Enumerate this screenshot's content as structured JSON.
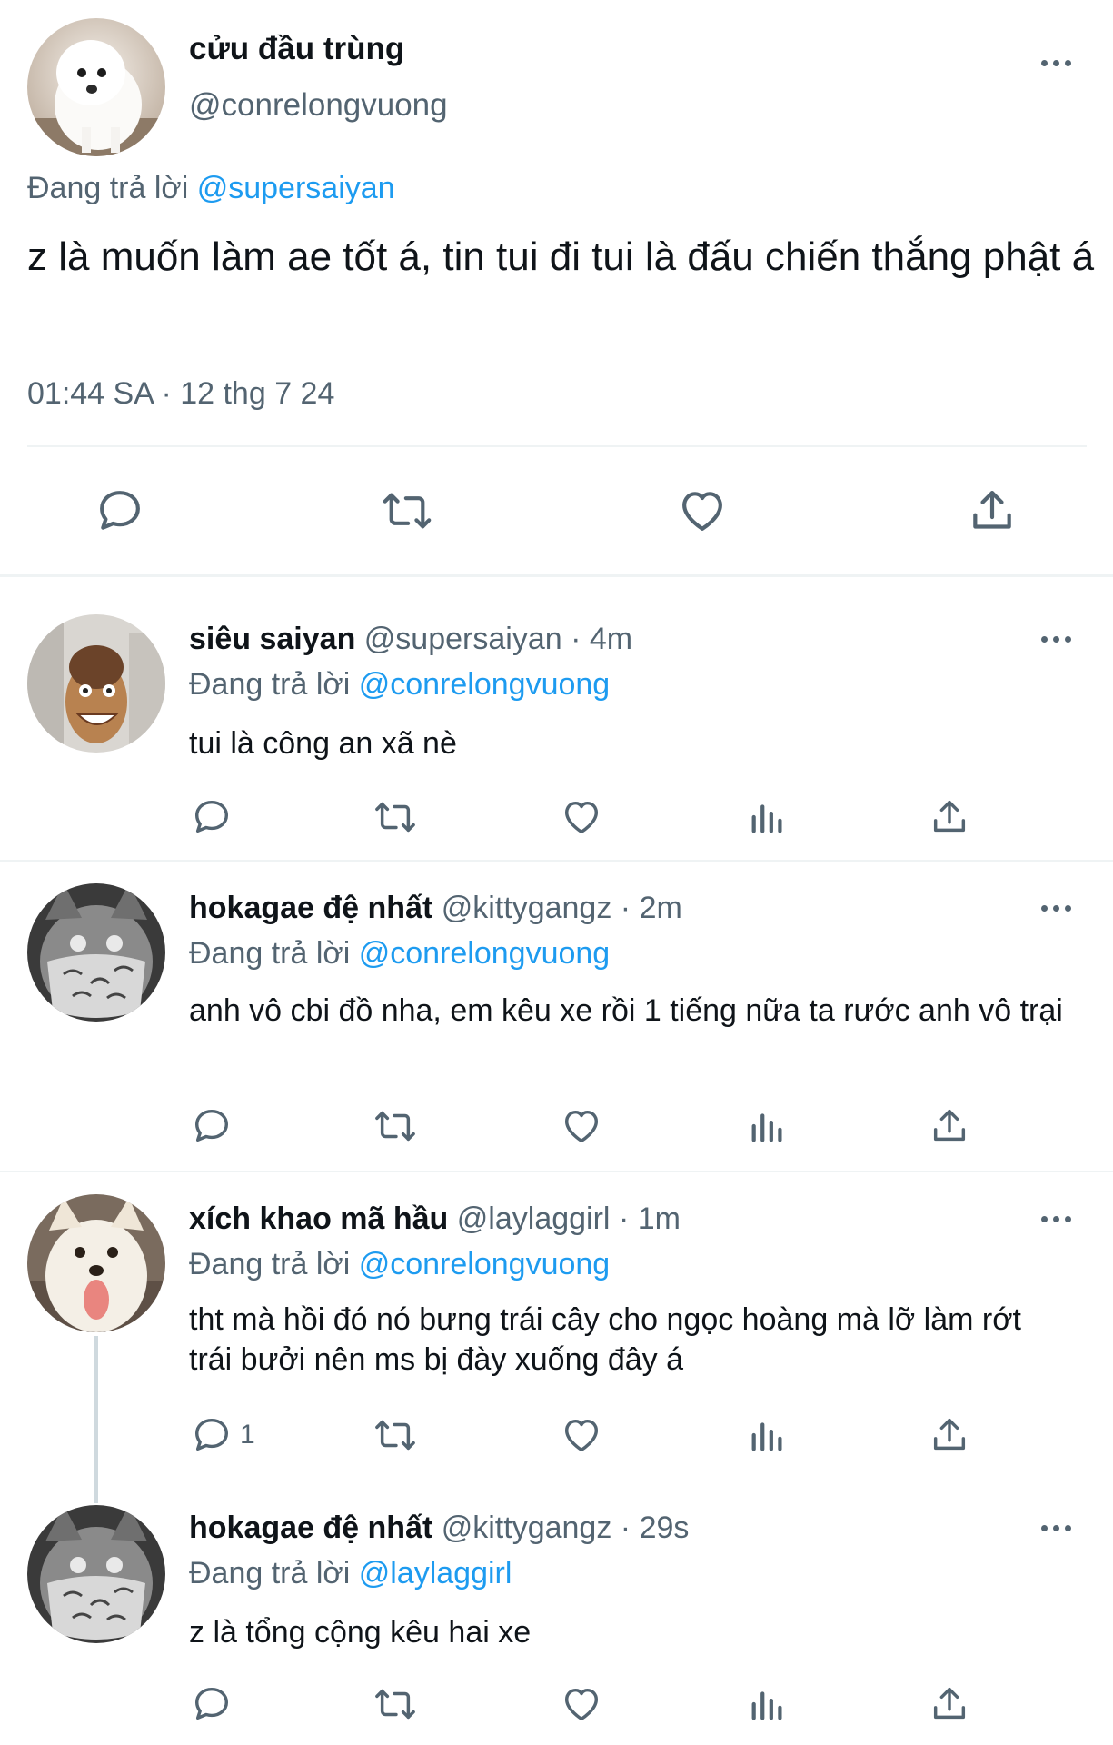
{
  "main_tweet": {
    "display_name": "cửu đầu trùng",
    "handle": "@conrelongvuong",
    "reply_prefix": "Đang trả lời",
    "reply_to": "@supersaiyan",
    "text": "z là muốn làm ae tốt á, tin tui đi tui là đấu chiến thắng phật á",
    "timestamp": "01:44 SA · 12 thg 7 24"
  },
  "replies": [
    {
      "display_name": "siêu saiyan",
      "handle": "@supersaiyan",
      "age": "· 4m",
      "reply_prefix": "Đang trả lời",
      "reply_to": "@conrelongvuong",
      "text": "tui là công an xã nè",
      "reply_count": ""
    },
    {
      "display_name": "hokagae đệ nhất",
      "handle": "@kittygangz",
      "age": "· 2m",
      "reply_prefix": "Đang trả lời",
      "reply_to": "@conrelongvuong",
      "text": "anh vô cbi đồ nha, em kêu xe rồi 1 tiếng nữa ta rước anh vô trại",
      "reply_count": ""
    },
    {
      "display_name": "xích khao mã hầu",
      "handle": "@laylaggirl",
      "age": "· 1m",
      "reply_prefix": "Đang trả lời",
      "reply_to": "@conrelongvuong",
      "text": "tht mà hồi đó nó bưng trái cây cho ngọc hoàng mà lỡ làm rớt trái bưởi nên ms bị đày xuống đây á",
      "reply_count": "1"
    },
    {
      "display_name": "hokagae đệ nhất",
      "handle": "@kittygangz",
      "age": "· 29s",
      "reply_prefix": "Đang trả lời",
      "reply_to": "@laylaggirl",
      "text": "z là tổng cộng kêu hai xe",
      "reply_count": ""
    }
  ],
  "icons": {
    "avatars": [
      "white-poodle-avatar",
      "grinning-puppet-avatar",
      "masked-cat-avatar",
      "white-dog-avatar",
      "masked-cat-avatar"
    ],
    "actions": [
      "reply-icon",
      "retweet-icon",
      "like-icon",
      "views-icon",
      "share-icon"
    ]
  },
  "colors": {
    "link": "#1d9bf0",
    "muted": "#536471",
    "text": "#0f1419",
    "divider": "#eff3f4"
  }
}
